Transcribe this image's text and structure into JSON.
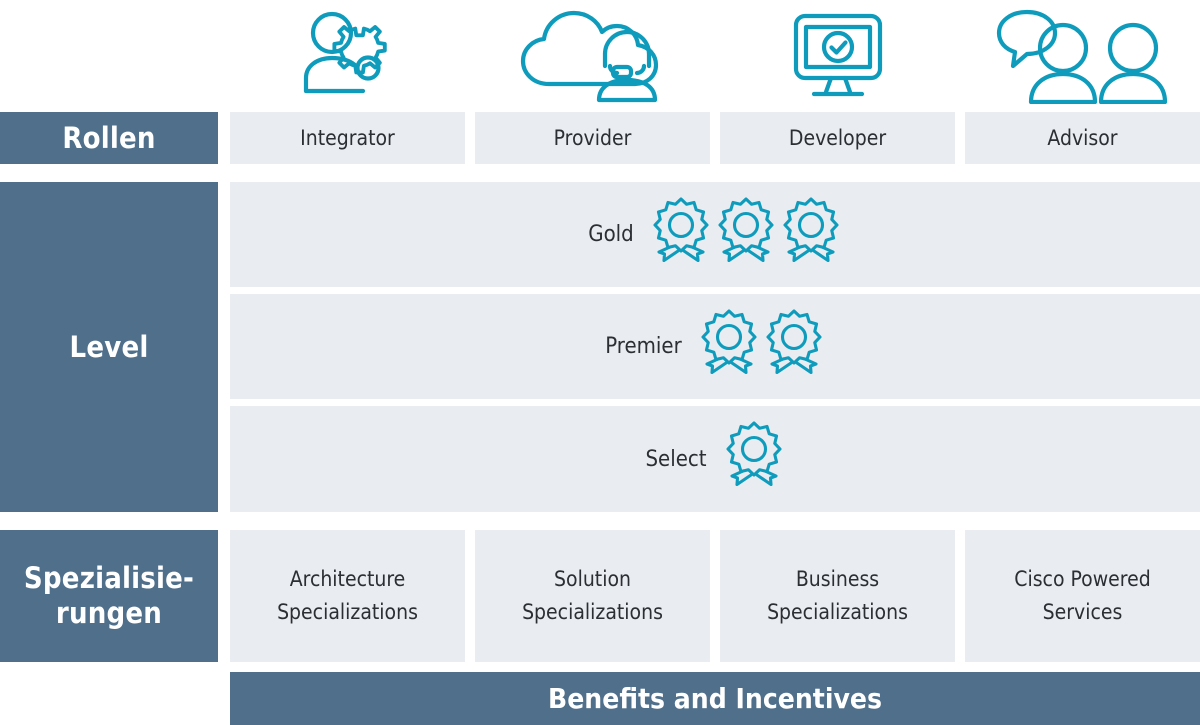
{
  "colors": {
    "label_blue": "#4f6f8b",
    "cell_gray": "#e9ecf1",
    "icon_teal": "#0f9cbc",
    "text_dark": "#2b2f33",
    "text_light": "#ffffff",
    "page_background": "#ffffff"
  },
  "rows": {
    "roles_label": "Rollen",
    "level_label": "Level",
    "spec_label_line1": "Spezialisie-",
    "spec_label_line2": "rungen"
  },
  "roles": [
    {
      "name": "Integrator",
      "icon": "person-gear-icon"
    },
    {
      "name": "Provider",
      "icon": "cloud-headset-agent-icon"
    },
    {
      "name": "Developer",
      "icon": "monitor-check-icon"
    },
    {
      "name": "Advisor",
      "icon": "two-people-speech-bubble-icon"
    }
  ],
  "levels": [
    {
      "name": "Gold",
      "badge_count": 3,
      "badge_icon": "rosette-award-icon"
    },
    {
      "name": "Premier",
      "badge_count": 2,
      "badge_icon": "rosette-award-icon"
    },
    {
      "name": "Select",
      "badge_count": 1,
      "badge_icon": "rosette-award-icon"
    }
  ],
  "specializations": [
    {
      "line1": "Architecture",
      "line2": "Specializations"
    },
    {
      "line1": "Solution",
      "line2": "Specializations"
    },
    {
      "line1": "Business",
      "line2": "Specializations"
    },
    {
      "line1": "Cisco Powered",
      "line2": "Services"
    }
  ],
  "footer": {
    "label": "Benefits and Incentives"
  }
}
